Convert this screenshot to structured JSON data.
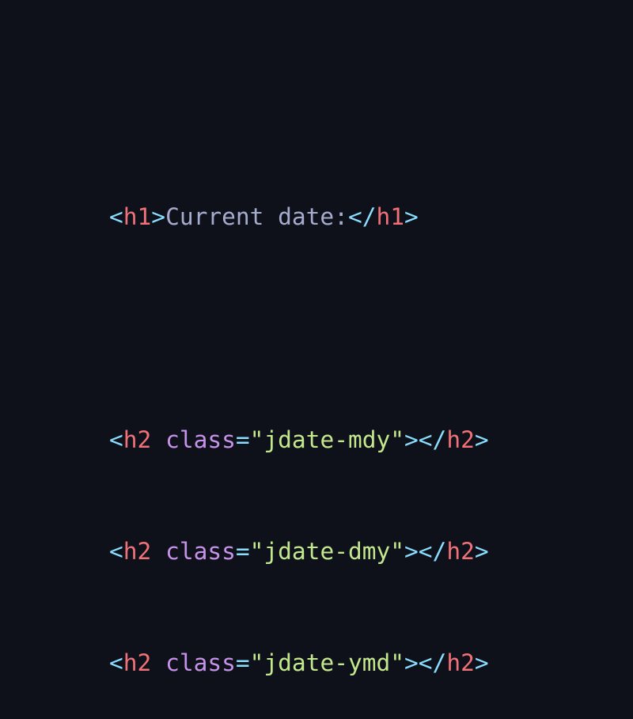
{
  "colors": {
    "background": "#0f111a",
    "bracket": "#89ddff",
    "tag": "#f07178",
    "text": "#a6accd",
    "attribute": "#c792ea",
    "string": "#c3e88d"
  },
  "code": {
    "line1": {
      "open_bracket": "<",
      "open_tag": "h1",
      "open_close_bracket": ">",
      "text": "Current date:",
      "close_open_bracket": "</",
      "close_tag": "h1",
      "close_bracket": ">"
    },
    "line2": {
      "open_bracket": "<",
      "tag": "h2",
      "attr": "class",
      "equals": "=",
      "value": "\"jdate-mdy\"",
      "end": "></",
      "close_tag": "h2",
      "close_bracket": ">"
    },
    "line3": {
      "open_bracket": "<",
      "tag": "h2",
      "attr": "class",
      "equals": "=",
      "value": "\"jdate-dmy\"",
      "end": "></",
      "close_tag": "h2",
      "close_bracket": ">"
    },
    "line4": {
      "open_bracket": "<",
      "tag": "h2",
      "attr": "class",
      "equals": "=",
      "value": "\"jdate-ymd\"",
      "end": "></",
      "close_tag": "h2",
      "close_bracket": ">"
    }
  }
}
